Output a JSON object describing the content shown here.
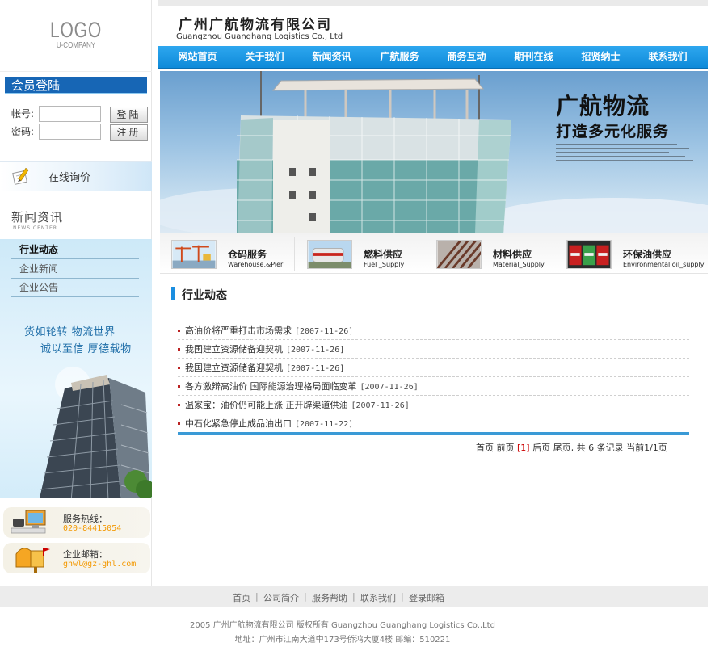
{
  "logo": {
    "line1": "LOGO",
    "line2": "U-COMPANY"
  },
  "company": {
    "cn_name": "广州广航物流有限公司",
    "en_name": "Guangzhou Guanghang Logistics Co., Ltd"
  },
  "nav": {
    "items": [
      "网站首页",
      "关于我们",
      "新闻资讯",
      "广航服务",
      "商务互动",
      "期刊在线",
      "招贤纳士",
      "联系我们"
    ]
  },
  "login": {
    "title": "会员登陆",
    "account_label": "帐号:",
    "password_label": "密码:",
    "account_value": "",
    "password_value": "",
    "login_button": "登陆",
    "register_button": "注册"
  },
  "inquiry": {
    "label": "在线询价",
    "icon": "pen-paper-icon"
  },
  "news_center": {
    "title": "新闻资讯",
    "subtitle": "NEWS CENTER",
    "items": [
      {
        "label": "行业动态",
        "active": true
      },
      {
        "label": "企业新闻",
        "active": false
      },
      {
        "label": "企业公告",
        "active": false
      }
    ]
  },
  "slogan": {
    "line1": "货如轮转  物流世界",
    "line2": "诚以至信  厚德载物"
  },
  "contacts": {
    "hotline_title": "服务热线：",
    "hotline_value": "020-84415054",
    "email_title": "企业邮箱：",
    "email_value": "ghwl@gz-ghl.com",
    "hotline_icon": "computer-phone-icon",
    "email_icon": "mailbox-icon"
  },
  "banner": {
    "headline": "广航物流",
    "subline": "打造多元化服务"
  },
  "services": [
    {
      "cn": "仓码服务",
      "en": "Warehouse,&Pier",
      "icon": "crane-icon"
    },
    {
      "cn": "燃料供应",
      "en": "Fuel _Supply",
      "icon": "fuel-tank-icon"
    },
    {
      "cn": "材料供应",
      "en": "Material_Supply",
      "icon": "pipes-icon"
    },
    {
      "cn": "环保油供应",
      "en": "Environmental oil_supply",
      "icon": "oil-drums-icon"
    }
  ],
  "section": {
    "title": "行业动态"
  },
  "articles": [
    {
      "title": "高油价将严重打击市场需求",
      "date": "[2007-11-26]"
    },
    {
      "title": "我国建立资源储备迎契机",
      "date": "[2007-11-26]"
    },
    {
      "title": "我国建立资源储备迎契机",
      "date": "[2007-11-26]"
    },
    {
      "title": "各方激辩高油价 国际能源治理格局面临变革",
      "date": "[2007-11-26]"
    },
    {
      "title": "温家宝：油价仍可能上涨 正开辟渠道供油",
      "date": "[2007-11-26]"
    },
    {
      "title": "中石化紧急停止成品油出口",
      "date": "[2007-11-22]"
    }
  ],
  "pager": {
    "first": "首页",
    "prev": "前页",
    "current": "[1]",
    "next": "后页",
    "last": "尾页,",
    "total": "共 6 条记录",
    "page_info": "当前1/1页"
  },
  "footer": {
    "links": [
      "首页",
      "公司简介",
      "服务帮助",
      "联系我们",
      "登录邮箱"
    ],
    "separator": "|",
    "copyright": "2005 广州广航物流有限公司 版权所有 Guangzhou Guanghang Logistics Co.,Ltd",
    "address": "地址：广州市江南大道中173号侨鸿大厦4楼 邮编：510221"
  },
  "colors": {
    "nav_blue": "#1a96e3",
    "login_title_blue": "#1766b5",
    "accent_orange": "#f39800",
    "pager_current": "#cc0000"
  }
}
